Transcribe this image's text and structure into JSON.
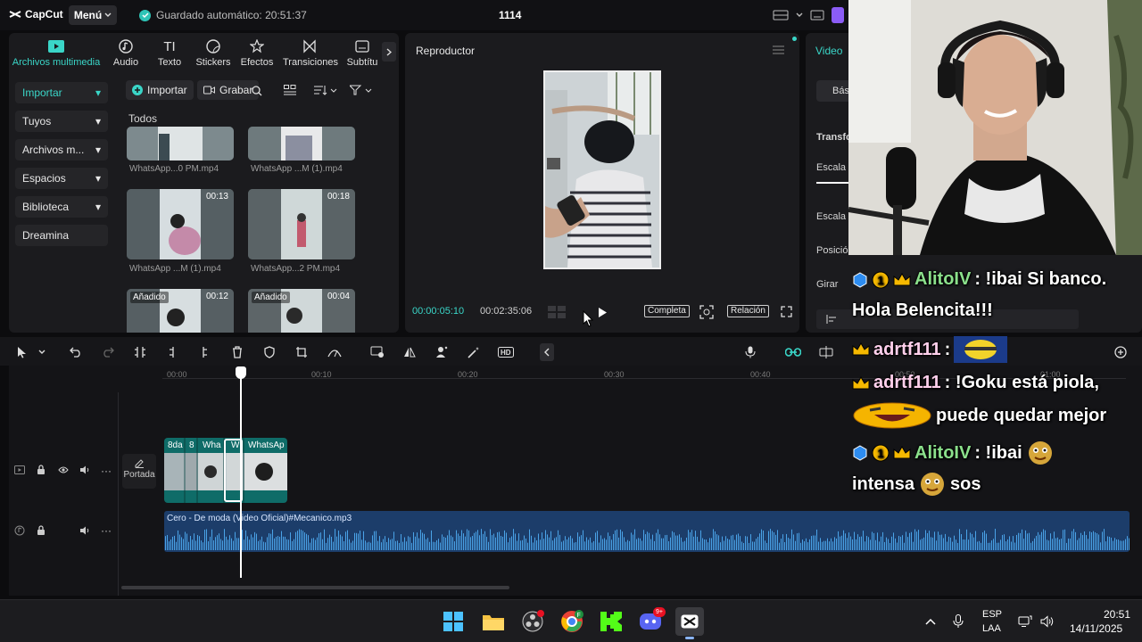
{
  "titlebar": {
    "app_name": "CapCut",
    "menu_label": "Menú",
    "autosave": "Guardado automático: 20:51:37",
    "project_title": "1114"
  },
  "media_panel": {
    "tabs": [
      {
        "label": "Archivos multimedia",
        "icon": "media-icon",
        "active": true
      },
      {
        "label": "Audio",
        "icon": "audio-icon"
      },
      {
        "label": "Texto",
        "icon": "text-icon"
      },
      {
        "label": "Stickers",
        "icon": "sticker-icon"
      },
      {
        "label": "Efectos",
        "icon": "effects-icon"
      },
      {
        "label": "Transiciones",
        "icon": "transitions-icon"
      },
      {
        "label": "Subtítu",
        "icon": "subtitles-icon"
      }
    ],
    "sidebar": [
      {
        "label": "Importar",
        "active": true
      },
      {
        "label": "Tuyos"
      },
      {
        "label": "Archivos m..."
      },
      {
        "label": "Espacios"
      },
      {
        "label": "Biblioteca"
      },
      {
        "label": "Dreamina"
      }
    ],
    "import_label": "Importar",
    "record_label": "Grabar",
    "section_label": "Todos",
    "thumbnails": [
      {
        "label": "WhatsApp...0 PM.mp4",
        "duration": "",
        "badge": ""
      },
      {
        "label": "WhatsApp ...M (1).mp4",
        "duration": "",
        "badge": ""
      },
      {
        "label": "WhatsApp ...M (1).mp4",
        "duration": "00:13",
        "badge": ""
      },
      {
        "label": "WhatsApp...2 PM.mp4",
        "duration": "00:18",
        "badge": ""
      },
      {
        "label": "",
        "duration": "00:12",
        "badge": "Añadido"
      },
      {
        "label": "",
        "duration": "00:04",
        "badge": "Añadido"
      }
    ]
  },
  "player": {
    "title": "Reproductor",
    "current_time": "00:00:05:10",
    "total_time": "00:02:35:06",
    "full_label": "Completa",
    "ratio_label": "Relación"
  },
  "props": {
    "title": "Video",
    "basic_tab": "Bás",
    "transform_label": "Transfo",
    "scale_label": "Escala",
    "scale2_label": "Escala",
    "position_label": "Posición",
    "rotate_label": "Girar"
  },
  "timeline": {
    "ruler": [
      "00:00",
      "00:10",
      "00:20",
      "00:30",
      "00:40",
      "00:50",
      "01:00"
    ],
    "cover_label": "Portada",
    "clip_labels": [
      "8da",
      "8",
      "Wha",
      "W",
      "WhatsAp"
    ],
    "audio_clip": "Cero - De moda (Video Oficial)#Mecanico.mp3"
  },
  "chat": [
    {
      "user": "AlitoIV",
      "text": ": !ibai Si banco.",
      "color": "green",
      "badges": [
        "cube-icon",
        "one-icon",
        "crown-icon"
      ]
    },
    {
      "user": "",
      "text": "Hola Belencita!!!",
      "color": "",
      "badges": []
    },
    {
      "user": "adrtf111",
      "text": ":",
      "color": "pink",
      "badges": [
        "crown-icon"
      ]
    },
    {
      "user": "adrtf111",
      "text": ": !Goku está piola,",
      "color": "pink",
      "badges": [
        "crown-icon"
      ]
    },
    {
      "user": "",
      "text": "puede quedar mejor",
      "color": "",
      "badges": []
    },
    {
      "user": "AlitoIV",
      "text": ": !ibai",
      "color": "green",
      "badges": [
        "cube-icon",
        "one-icon",
        "crown-icon"
      ]
    },
    {
      "user": "",
      "text": "intensa",
      "color": "",
      "badges": []
    },
    {
      "user": "",
      "text": "sos",
      "color": "",
      "badges": []
    }
  ],
  "taskbar": {
    "lang_line1": "ESP",
    "lang_line2": "LAA",
    "time": "20:51",
    "date": "14/11/2025",
    "discord_badge": "9+"
  },
  "colors": {
    "accent": "#3ad6c8",
    "panel": "#1b1b1e",
    "video_track": "#0f6c68",
    "audio_track": "#1c3d6a"
  }
}
